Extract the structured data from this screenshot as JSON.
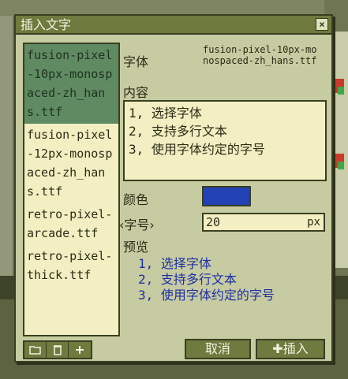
{
  "dialog": {
    "title": "插入文字",
    "close_icon": "×"
  },
  "font_list": [
    "fusion-pixel-10px-monospaced-zh_hans.ttf",
    "fusion-pixel-12px-monospaced-zh_hans.ttf",
    "retro-pixel-arcade.ttf",
    "retro-pixel-thick.ttf"
  ],
  "font": {
    "label": "字体",
    "value": "fusion-pixel-10px-monospaced-zh_hans.ttf"
  },
  "content": {
    "label": "内容",
    "value": "1, 选择字体\n2, 支持多行文本\n3, 使用字体约定的字号"
  },
  "color": {
    "label": "颜色",
    "value": "#2342b5"
  },
  "size": {
    "label": "‹字号›",
    "value": "20",
    "unit": "px"
  },
  "preview": {
    "label": "预览",
    "text": "1, 选择字体\n2, 支持多行文本\n3, 使用字体约定的字号"
  },
  "buttons": {
    "cancel": "取消",
    "insert": "✚插入"
  }
}
